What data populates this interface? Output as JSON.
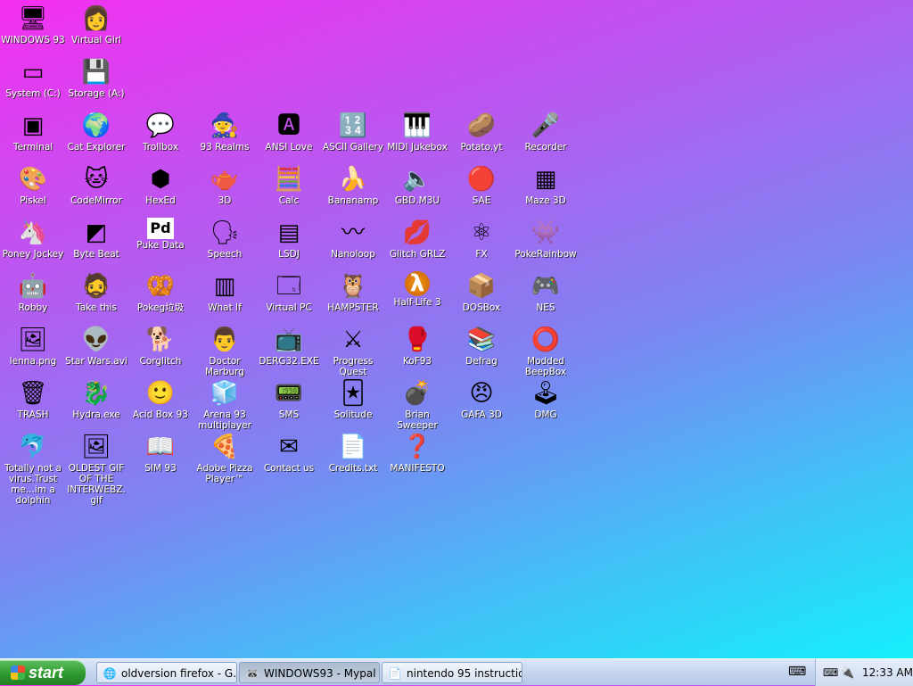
{
  "desktop_icons": [
    {
      "label": "WINDOWS 93",
      "glyph": "🖥"
    },
    {
      "label": "Virtual Girl",
      "glyph": "👩"
    },
    {
      "label": "System (C:)",
      "glyph": "▭"
    },
    {
      "label": "Storage (A:)",
      "glyph": "💾"
    },
    {
      "label": "Terminal",
      "glyph": "▣"
    },
    {
      "label": "Cat Explorer",
      "glyph": "🌍"
    },
    {
      "label": "Trollbox",
      "glyph": "💬"
    },
    {
      "label": "93 Realms",
      "glyph": "🧙"
    },
    {
      "label": "ANSI Love",
      "glyph": "🅰"
    },
    {
      "label": "ASCII Gallery",
      "glyph": "🔢"
    },
    {
      "label": "MIDI Jukebox",
      "glyph": "🎹"
    },
    {
      "label": "Potato.yt",
      "glyph": "🥔"
    },
    {
      "label": "Recorder",
      "glyph": "🎤"
    },
    {
      "label": "Piskel",
      "glyph": "🎨"
    },
    {
      "label": "CodeMirror",
      "glyph": "🐱"
    },
    {
      "label": "HexEd",
      "glyph": "⬢"
    },
    {
      "label": "3D",
      "glyph": "🫖"
    },
    {
      "label": "Calc",
      "glyph": "🧮"
    },
    {
      "label": "Bananamp",
      "glyph": "🍌"
    },
    {
      "label": "GBD.M3U",
      "glyph": "🔈"
    },
    {
      "label": "SAE",
      "glyph": "🔴"
    },
    {
      "label": "Maze 3D",
      "glyph": "▦"
    },
    {
      "label": "Poney Jockey",
      "glyph": "🦄"
    },
    {
      "label": "Byte Beat",
      "glyph": "◩"
    },
    {
      "label": "Puke Data",
      "glyph": "Pd"
    },
    {
      "label": "Speech",
      "glyph": "🗣"
    },
    {
      "label": "LSDJ",
      "glyph": "▤"
    },
    {
      "label": "Nanoloop",
      "glyph": "〰"
    },
    {
      "label": "Glitch GRLZ",
      "glyph": "💋"
    },
    {
      "label": "FX",
      "glyph": "⚛"
    },
    {
      "label": "PokeRainbow",
      "glyph": "👾"
    },
    {
      "label": "Robby",
      "glyph": "🤖"
    },
    {
      "label": "Take this",
      "glyph": "🧔"
    },
    {
      "label": "Pokeg垃圾",
      "glyph": "🥨"
    },
    {
      "label": "What If",
      "glyph": "▥"
    },
    {
      "label": "Virtual PC",
      "glyph": "🗔"
    },
    {
      "label": "HAMPSTER",
      "glyph": "🦉"
    },
    {
      "label": "Half-Life 3",
      "glyph": "λ"
    },
    {
      "label": "DOSBox",
      "glyph": "📦"
    },
    {
      "label": "NES",
      "glyph": "🎮"
    },
    {
      "label": "lenna.png",
      "glyph": "🖼"
    },
    {
      "label": "Star Wars.avi",
      "glyph": "👽"
    },
    {
      "label": "Corglitch",
      "glyph": "🐕"
    },
    {
      "label": "Doctor Marburg",
      "glyph": "👨"
    },
    {
      "label": "DERG32.EXE",
      "glyph": "📺"
    },
    {
      "label": "Progress Quest",
      "glyph": "⚔"
    },
    {
      "label": "KoF93",
      "glyph": "🥊"
    },
    {
      "label": "Defrag",
      "glyph": "📚"
    },
    {
      "label": "Modded BeepBox",
      "glyph": "⭕"
    },
    {
      "label": "TRASH",
      "glyph": "🗑"
    },
    {
      "label": "Hydra.exe",
      "glyph": "🐉"
    },
    {
      "label": "Acid Box 93",
      "glyph": "🙂"
    },
    {
      "label": "Arena 93 multiplayer",
      "glyph": "🧊"
    },
    {
      "label": "SMS",
      "glyph": "📟"
    },
    {
      "label": "Solitude",
      "glyph": "🃏"
    },
    {
      "label": "Brian Sweeper",
      "glyph": "💣"
    },
    {
      "label": "GAFA 3D",
      "glyph": "😠"
    },
    {
      "label": "DMG",
      "glyph": "🕹"
    },
    {
      "label": "Totally not a virus.Trust me...im a dolphin",
      "glyph": "🐬"
    },
    {
      "label": "OLDEST GIF OF THE INTERWEBZ.gif",
      "glyph": "🖼"
    },
    {
      "label": "SIM 93",
      "glyph": "📖"
    },
    {
      "label": "Adobe Pizza Player™",
      "glyph": "🍕"
    },
    {
      "label": "Contact us",
      "glyph": "✉"
    },
    {
      "label": "Credits.txt",
      "glyph": "📄"
    },
    {
      "label": "MANIFESTO",
      "glyph": "❓"
    }
  ],
  "taskbar": {
    "start_label": "start",
    "tasks": [
      {
        "label": "oldversion firefox - G...",
        "icon": "🌐"
      },
      {
        "label": "WINDOWS93 - Mypal",
        "icon": "🦝"
      },
      {
        "label": "nintendo 95 instructio...",
        "icon": "📄"
      }
    ],
    "keyboard_icon": "⌨",
    "tray_icons": [
      "⌨",
      "🔌"
    ],
    "clock": "12:33 AM"
  }
}
